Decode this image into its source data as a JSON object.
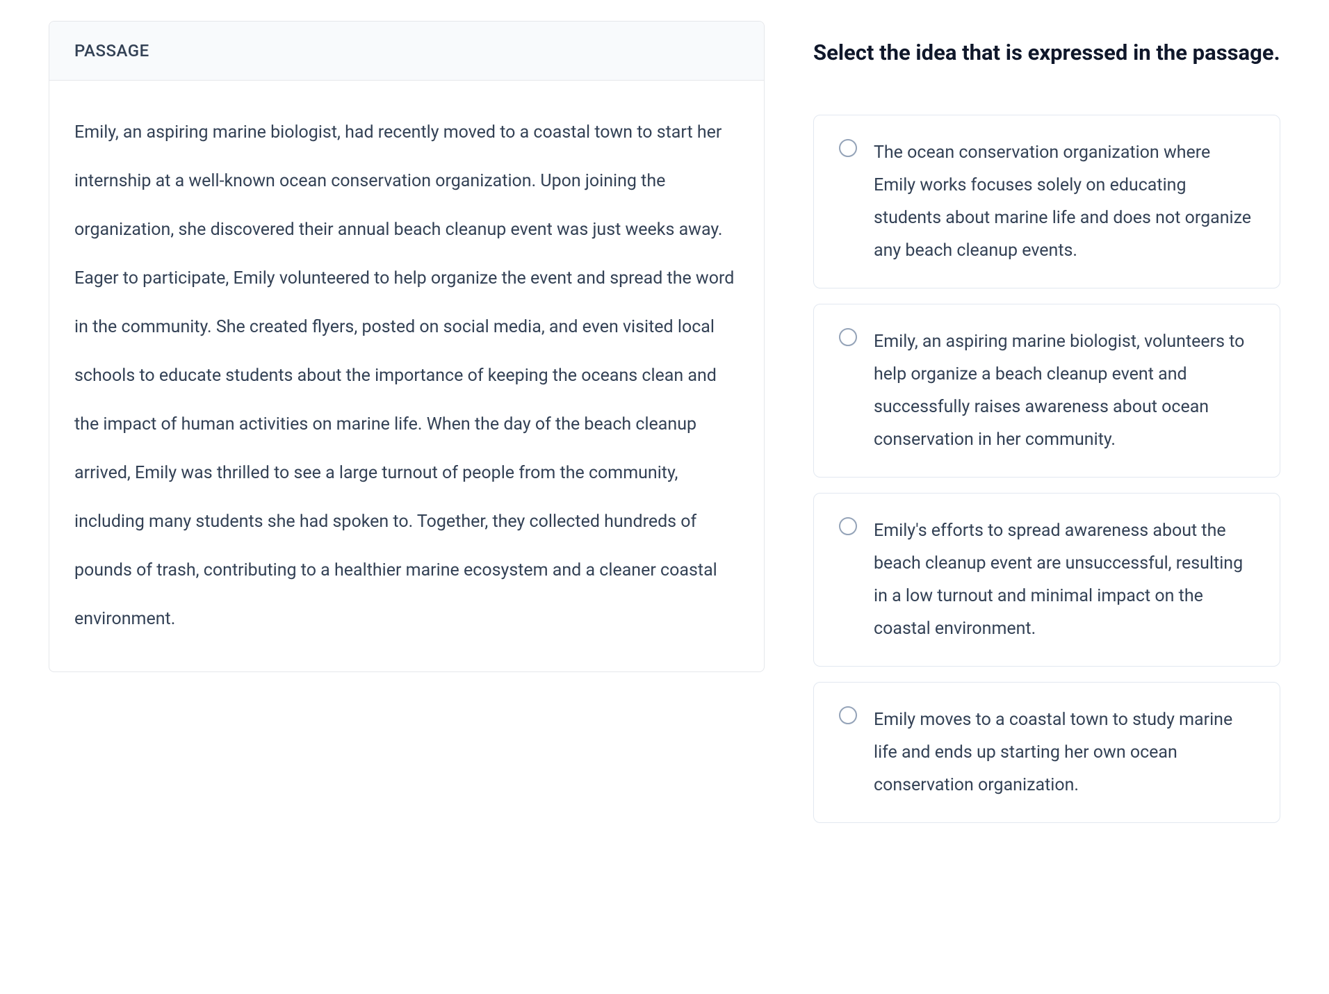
{
  "passage": {
    "header_label": "PASSAGE",
    "body": "Emily, an aspiring marine biologist, had recently moved to a coastal town to start her internship at a well-known ocean conservation organization. Upon joining the organization, she discovered their annual beach cleanup event was just weeks away. Eager to participate, Emily volunteered to help organize the event and spread the word in the community. She created flyers, posted on social media, and even visited local schools to educate students about the importance of keeping the oceans clean and the impact of human activities on marine life. When the day of the beach cleanup arrived, Emily was thrilled to see a large turnout of people from the community, including many students she had spoken to. Together, they collected hundreds of pounds of trash, contributing to a healthier marine ecosystem and a cleaner coastal environment."
  },
  "question": {
    "title": "Select the idea that is expressed in the passage.",
    "options": [
      "The ocean conservation organization where Emily works focuses solely on educating students about marine life and does not organize any beach cleanup events.",
      "Emily, an aspiring marine biologist, volunteers to help organize a beach cleanup event and successfully raises awareness about ocean conservation in her community.",
      "Emily's efforts to spread awareness about the beach cleanup event are unsuccessful, resulting in a low turnout and minimal impact on the coastal environment.",
      "Emily moves to a coastal town to study marine life and ends up starting her own ocean conservation organization."
    ]
  }
}
